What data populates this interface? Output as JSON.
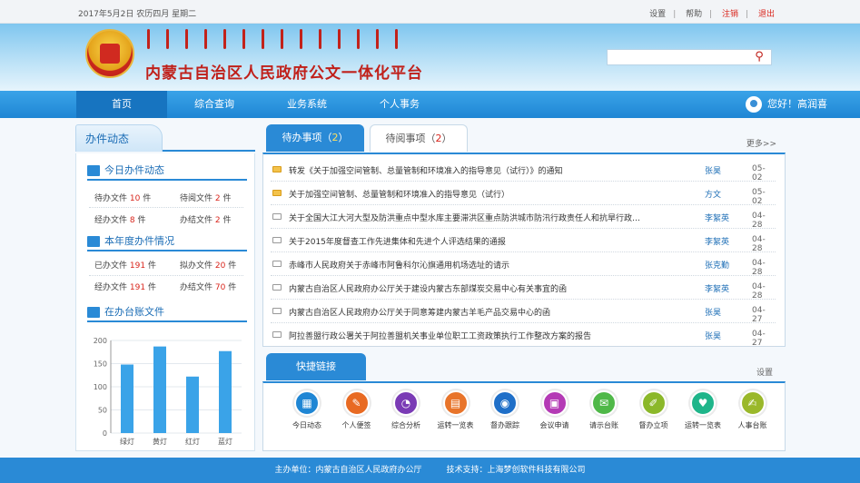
{
  "topbar": {
    "date": "2017年5月2日  农历四月  星期二",
    "settings": "设置",
    "help": "帮助",
    "logout": "注销",
    "exit": "退出"
  },
  "header": {
    "title": "内蒙古自治区人民政府公文一体化平台"
  },
  "nav": {
    "items": [
      "首页",
      "综合查询",
      "业务系统",
      "个人事务"
    ],
    "greeting": "您好！高润喜"
  },
  "left": {
    "tab": "办件动态",
    "today": {
      "title": "今日办件动态",
      "todo_label": "待办文件",
      "todo_count": "10",
      "todo_unit": "件",
      "toread_label": "待阅文件",
      "toread_count": "2",
      "toread_unit": "件",
      "handled_label": "经办文件",
      "handled_count": "8",
      "handled_unit": "件",
      "done_label": "办结文件",
      "done_count": "2",
      "done_unit": "件"
    },
    "year": {
      "title": "本年度办件情况",
      "sent_label": "已办文件",
      "sent_count": "191",
      "sent_unit": "件",
      "draft_label": "拟办文件",
      "draft_count": "20",
      "draft_unit": "件",
      "handled_label": "经办文件",
      "handled_count": "191",
      "handled_unit": "件",
      "done_label": "办结文件",
      "done_count": "70",
      "done_unit": "件"
    },
    "ledger_title": "在办台账文件"
  },
  "chart_data": {
    "type": "bar",
    "categories": [
      "绿灯",
      "黄灯",
      "红灯",
      "蓝灯"
    ],
    "values": [
      148,
      187,
      122,
      177
    ],
    "ylim": [
      0,
      200
    ],
    "yticks": [
      "200",
      "150",
      "100",
      "50",
      "0"
    ],
    "color": "#3aa3e8"
  },
  "main": {
    "tabs": {
      "todo_label": "待办事项（",
      "todo_count": "2",
      "todo_end": "）",
      "read_label": "待阅事项（",
      "read_count": "2",
      "read_end": "）"
    },
    "more": "更多>>",
    "items": [
      {
        "title": "转发《关于加强空间管制、总量管制和环境准入的指导意见（试行）》的通知",
        "user": "张昊",
        "date": "05-02",
        "unread": true
      },
      {
        "title": "关于加强空间管制、总量管制和环境准入的指导意见（试行）",
        "user": "方文",
        "date": "05-02",
        "unread": true
      },
      {
        "title": "关于全国大江大河大型及防洪重点中型水库主要滞洪区重点防洪城市防汛行政责任人和抗旱行政…",
        "user": "李絮英",
        "date": "04-28",
        "unread": false
      },
      {
        "title": "关于2015年度督查工作先进集体和先进个人评选结果的通报",
        "user": "李絮英",
        "date": "04-28",
        "unread": false
      },
      {
        "title": "赤峰市人民政府关于赤峰市阿鲁科尔沁旗通用机场选址的请示",
        "user": "张克勤",
        "date": "04-28",
        "unread": false
      },
      {
        "title": "内蒙古自治区人民政府办公厅关于建设内蒙古东部煤炭交易中心有关事宜的函",
        "user": "李絮英",
        "date": "04-28",
        "unread": false
      },
      {
        "title": "内蒙古自治区人民政府办公厅关于同意筹建内蒙古羊毛产品交易中心的函",
        "user": "张昊",
        "date": "04-27",
        "unread": false
      },
      {
        "title": "阿拉善盟行政公署关于阿拉善盟机关事业单位职工工资政策执行工作整改方案的报告",
        "user": "张昊",
        "date": "04-27",
        "unread": false
      }
    ]
  },
  "quick": {
    "tab": "快捷链接",
    "settings": "设置",
    "items": [
      {
        "label": "今日动态",
        "color": "#1f86d4",
        "icon": "calendar-icon",
        "glyph": "▦"
      },
      {
        "label": "个人便签",
        "color": "#e86a22",
        "icon": "note-icon",
        "glyph": "✎"
      },
      {
        "label": "综合分析",
        "color": "#7a3bb5",
        "icon": "pie-icon",
        "glyph": "◔"
      },
      {
        "label": "运转一览表",
        "color": "#e8742a",
        "icon": "table-icon",
        "glyph": "▤"
      },
      {
        "label": "督办跟踪",
        "color": "#1f6fc8",
        "icon": "eye-icon",
        "glyph": "◉"
      },
      {
        "label": "会议申请",
        "color": "#b43ab5",
        "icon": "meeting-icon",
        "glyph": "▣"
      },
      {
        "label": "请示台账",
        "color": "#4fb848",
        "icon": "chat-icon",
        "glyph": "✉"
      },
      {
        "label": "督办立项",
        "color": "#8bb82a",
        "icon": "pencil-icon",
        "glyph": "✐"
      },
      {
        "label": "运转一览表",
        "color": "#1fb58a",
        "icon": "heart-icon",
        "glyph": "♥"
      },
      {
        "label": "人事台账",
        "color": "#9ab82a",
        "icon": "edit-icon",
        "glyph": "✍"
      }
    ]
  },
  "footer": {
    "host": "主办单位：内蒙古自治区人民政府办公厅",
    "support": "技术支持：上海梦创软件科技有限公司"
  }
}
